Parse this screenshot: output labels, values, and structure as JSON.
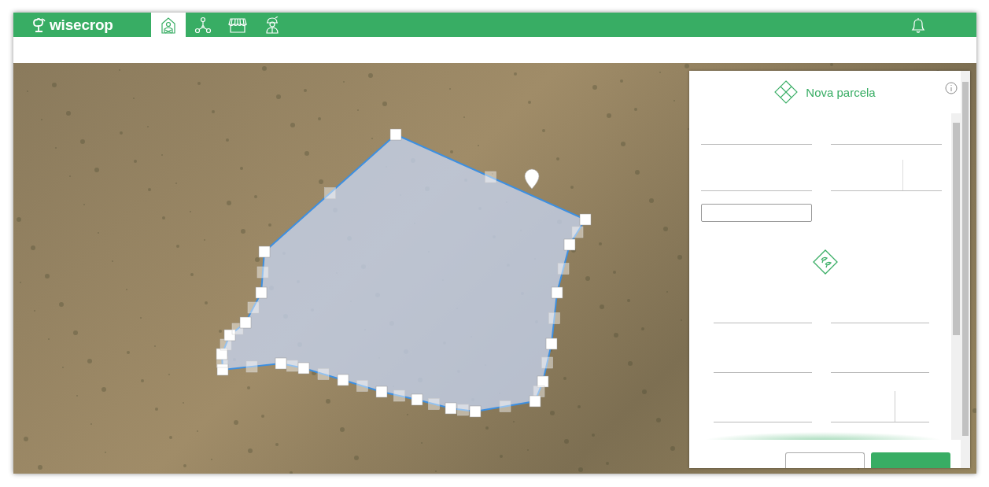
{
  "header": {
    "logo": "wisecrop",
    "nav_tabs": [
      {
        "selected": true
      },
      {
        "selected": false
      },
      {
        "selected": false
      },
      {
        "selected": false
      }
    ]
  },
  "panel": {
    "title": "Nova parcela"
  }
}
